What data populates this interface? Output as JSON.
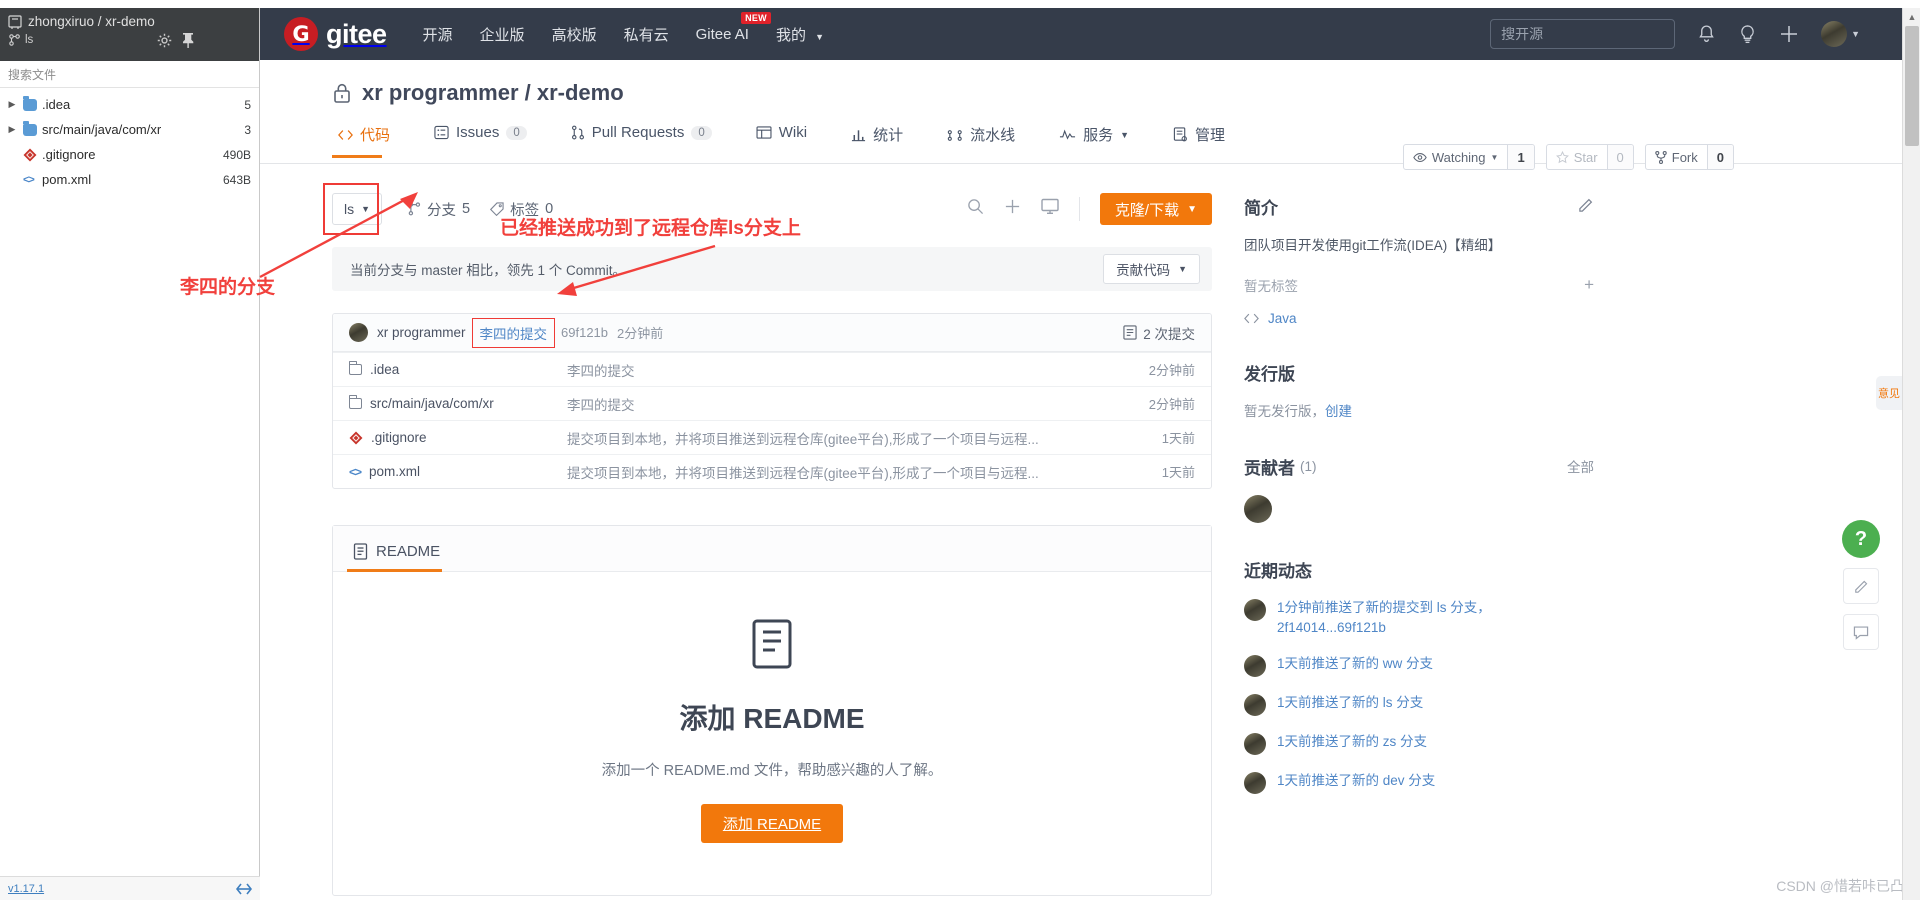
{
  "ide": {
    "repo_path": "zhongxiruo / xr-demo",
    "branch": "ls",
    "search_placeholder": "搜索文件",
    "tree": [
      {
        "name": ".idea",
        "size": "5",
        "type": "folder",
        "expandable": true
      },
      {
        "name": "src/main/java/com/xr",
        "size": "3",
        "type": "folder",
        "expandable": true
      },
      {
        "name": ".gitignore",
        "size": "490B",
        "type": "git",
        "expandable": false
      },
      {
        "name": "pom.xml",
        "size": "643B",
        "type": "xml",
        "expandable": false
      }
    ],
    "version": "v1.17.1"
  },
  "header": {
    "logo_text": "gitee",
    "logo_mark": "G",
    "nav": [
      {
        "label": "开源",
        "badge": ""
      },
      {
        "label": "企业版",
        "badge": ""
      },
      {
        "label": "高校版",
        "badge": ""
      },
      {
        "label": "私有云",
        "badge": ""
      },
      {
        "label": "Gitee AI",
        "badge": "NEW"
      },
      {
        "label": "我的",
        "badge": ""
      }
    ],
    "search_placeholder": "搜开源",
    "icons": [
      "bell-icon",
      "lightbulb-icon",
      "plus-icon",
      "avatar"
    ]
  },
  "repo": {
    "owner": "xr programmer",
    "name": "xr-demo",
    "full_title": "xr programmer / xr-demo",
    "private": true,
    "actions": [
      {
        "label": "Watching",
        "count": "1",
        "icon": "eye-icon",
        "disabled": false
      },
      {
        "label": "Star",
        "count": "0",
        "icon": "star-icon",
        "disabled": true
      },
      {
        "label": "Fork",
        "count": "0",
        "icon": "fork-icon",
        "disabled": false
      }
    ],
    "tabs": [
      {
        "label": "代码",
        "count": "",
        "icon": "code-icon",
        "active": true
      },
      {
        "label": "Issues",
        "count": "0",
        "icon": "issue-icon",
        "active": false
      },
      {
        "label": "Pull Requests",
        "count": "0",
        "icon": "pr-icon",
        "active": false
      },
      {
        "label": "Wiki",
        "count": "",
        "icon": "wiki-icon",
        "active": false
      },
      {
        "label": "统计",
        "count": "",
        "icon": "stats-icon",
        "active": false
      },
      {
        "label": "流水线",
        "count": "",
        "icon": "pipeline-icon",
        "active": false
      },
      {
        "label": "服务",
        "count": "",
        "icon": "service-icon",
        "active": false,
        "caret": true
      },
      {
        "label": "管理",
        "count": "",
        "icon": "manage-icon",
        "active": false
      }
    ]
  },
  "branch_bar": {
    "current_branch": "ls",
    "branches_label": "分支",
    "branches_count": "5",
    "tags_label": "标签",
    "tags_count": "0",
    "clone_label": "克隆/下载",
    "icons": [
      "search-icon",
      "plus-icon",
      "monitor-icon"
    ]
  },
  "ahead_bar": {
    "text": "当前分支与 master 相比，领先 1 个 Commit。",
    "contribute_label": "贡献代码"
  },
  "files": {
    "commit_author": "xr programmer",
    "commit_message": "李四的提交",
    "commit_sha": "69f121b",
    "commit_time": "2分钟前",
    "commit_count_label": "2 次提交",
    "rows": [
      {
        "name": ".idea",
        "type": "folder",
        "message": "李四的提交",
        "time": "2分钟前"
      },
      {
        "name": "src/main/java/com/xr",
        "type": "folder",
        "message": "李四的提交",
        "time": "2分钟前"
      },
      {
        "name": ".gitignore",
        "type": "git",
        "message": "提交项目到本地，并将项目推送到远程仓库(gitee平台),形成了一个项目与远程...",
        "time": "1天前"
      },
      {
        "name": "pom.xml",
        "type": "xml",
        "message": "提交项目到本地，并将项目推送到远程仓库(gitee平台),形成了一个项目与远程...",
        "time": "1天前"
      }
    ]
  },
  "readme": {
    "tab_label": "README",
    "title": "添加 README",
    "subtitle": "添加一个 README.md 文件，帮助感兴趣的人了解。",
    "button_label": "添加 README"
  },
  "sidebar": {
    "intro_title": "简介",
    "intro_desc": "团队项目开发使用git工作流(IDEA)【精细】",
    "no_tags": "暂无标签",
    "language": "Java",
    "release_title": "发行版",
    "release_note_prefix": "暂无发行版，",
    "release_note_link": "创建",
    "contributors_title": "贡献者",
    "contributors_count": "(1)",
    "contributors_all": "全部",
    "activity_title": "近期动态",
    "activities": [
      {
        "text": "1分钟前推送了新的提交到 ls 分支，2f14014...69f121b"
      },
      {
        "text": "1天前推送了新的 ww 分支"
      },
      {
        "text": "1天前推送了新的 ls 分支"
      },
      {
        "text": "1天前推送了新的 zs 分支"
      },
      {
        "text": "1天前推送了新的 dev 分支"
      }
    ]
  },
  "annotations": {
    "left_note": "李四的分支",
    "top_note": "已经推送成功到了远程仓库ls分支上"
  },
  "floating": {
    "pill_label": "意见",
    "help_label": "?",
    "buttons": [
      "edit-icon",
      "comment-icon"
    ]
  },
  "watermark": "CSDN @惜若咔已凸"
}
